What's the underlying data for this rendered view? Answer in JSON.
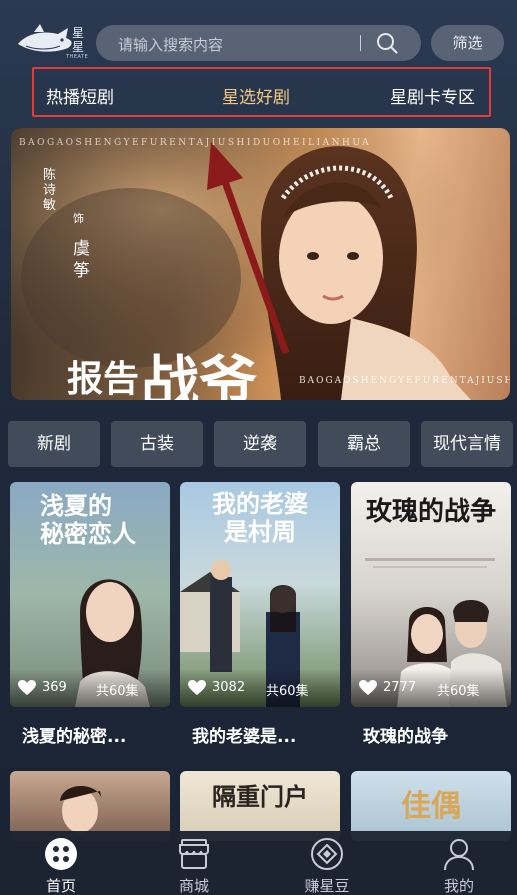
{
  "header": {
    "logo_text": "星星",
    "logo_sub": "THEATE",
    "search_placeholder": "请输入搜索内容",
    "filter_label": "筛选"
  },
  "tabs": [
    {
      "label": "热播短剧",
      "active": false
    },
    {
      "label": "星选好剧",
      "active": true
    },
    {
      "label": "星剧卡专区",
      "active": false
    }
  ],
  "banner": {
    "top_text": "BAOGAOSHENGYEFURENTAJIUSHIDUOHEILIANHUA",
    "cast": "陈诗敏",
    "role_word": "饰",
    "character": "虞筝",
    "title_part1": "报告",
    "title_part2": "战爷",
    "subtitle": "BAOGAOSHENGYEFURENTAJIUSHI"
  },
  "genres": [
    "新剧",
    "古装",
    "逆袭",
    "霸总",
    "现代言情"
  ],
  "cards": [
    {
      "poster_title_line1": "浅夏的",
      "poster_title_line2": "秘密恋人",
      "likes": "369",
      "episodes": "共60集",
      "title": "浅夏的秘密..."
    },
    {
      "poster_title_line1": "我的老婆",
      "poster_title_line2": "是村周",
      "likes": "3082",
      "episodes": "共60集",
      "title": "我的老婆是..."
    },
    {
      "poster_title_line1": "玫瑰的战争",
      "poster_title_line2": "",
      "likes": "2777",
      "episodes": "共60集",
      "title": "玫瑰的战争"
    }
  ],
  "cards_row2": [
    {
      "poster_text": ""
    },
    {
      "poster_text": "隔重门户"
    },
    {
      "poster_text": "佳偶"
    }
  ],
  "bottom_nav": [
    {
      "label": "首页",
      "icon": "home-icon",
      "active": true
    },
    {
      "label": "商城",
      "icon": "shop-icon",
      "active": false
    },
    {
      "label": "赚星豆",
      "icon": "diamond-icon",
      "active": false
    },
    {
      "label": "我的",
      "icon": "profile-icon",
      "active": false
    }
  ],
  "colors": {
    "active_tab": "#f0c983",
    "highlight_border": "#e03c3c",
    "annotation_arrow": "#8b1a1a"
  }
}
